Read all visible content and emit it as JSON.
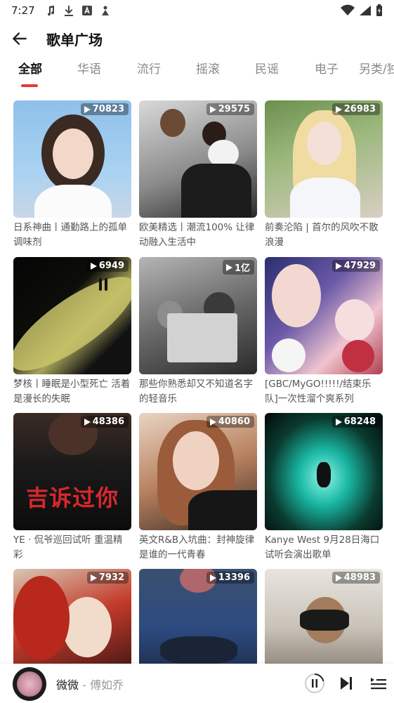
{
  "status_bar": {
    "time": "7:27"
  },
  "header": {
    "title": "歌单广场"
  },
  "tabs": [
    {
      "label": "全部",
      "active": true
    },
    {
      "label": "华语",
      "active": false
    },
    {
      "label": "流行",
      "active": false
    },
    {
      "label": "摇滚",
      "active": false
    },
    {
      "label": "民谣",
      "active": false
    },
    {
      "label": "电子",
      "active": false
    },
    {
      "label": "另类/独",
      "active": false
    }
  ],
  "playlists": [
    {
      "title": "日系神曲丨通勤路上的孤单调味剂",
      "play_count": "70823"
    },
    {
      "title": "欧美精选丨潮流100% 让律动融入生活中",
      "play_count": "29575"
    },
    {
      "title": "前奏沦陷 | 首尔的风吹不散浪漫",
      "play_count": "26983"
    },
    {
      "title": "梦核丨睡眠是小型死亡 活着是漫长的失眠",
      "play_count": "6949"
    },
    {
      "title": "那些你熟悉却又不知道名字的轻音乐",
      "play_count": "1亿"
    },
    {
      "title": "[GBC/MyGO!!!!!/结束乐队]一次性溜个爽系列",
      "play_count": "47929"
    },
    {
      "title": "YE · 侃爷巡回试听 重温精彩",
      "play_count": "48386"
    },
    {
      "title": "英文R&B入坑曲：封神旋律是谁的一代青春",
      "play_count": "40860"
    },
    {
      "title": "Kanye West 9月28日海口试听会演出歌单",
      "play_count": "68248"
    },
    {
      "title": "",
      "play_count": "7932"
    },
    {
      "title": "",
      "play_count": "13396"
    },
    {
      "title": "",
      "play_count": "48983"
    }
  ],
  "cover_texts": {
    "card7_overlay": "吉诉过你"
  },
  "player": {
    "song": "微微",
    "separator": " - ",
    "artist": "傅如乔"
  },
  "colors": {
    "accent": "#e53935",
    "tab_inactive": "#888888"
  }
}
